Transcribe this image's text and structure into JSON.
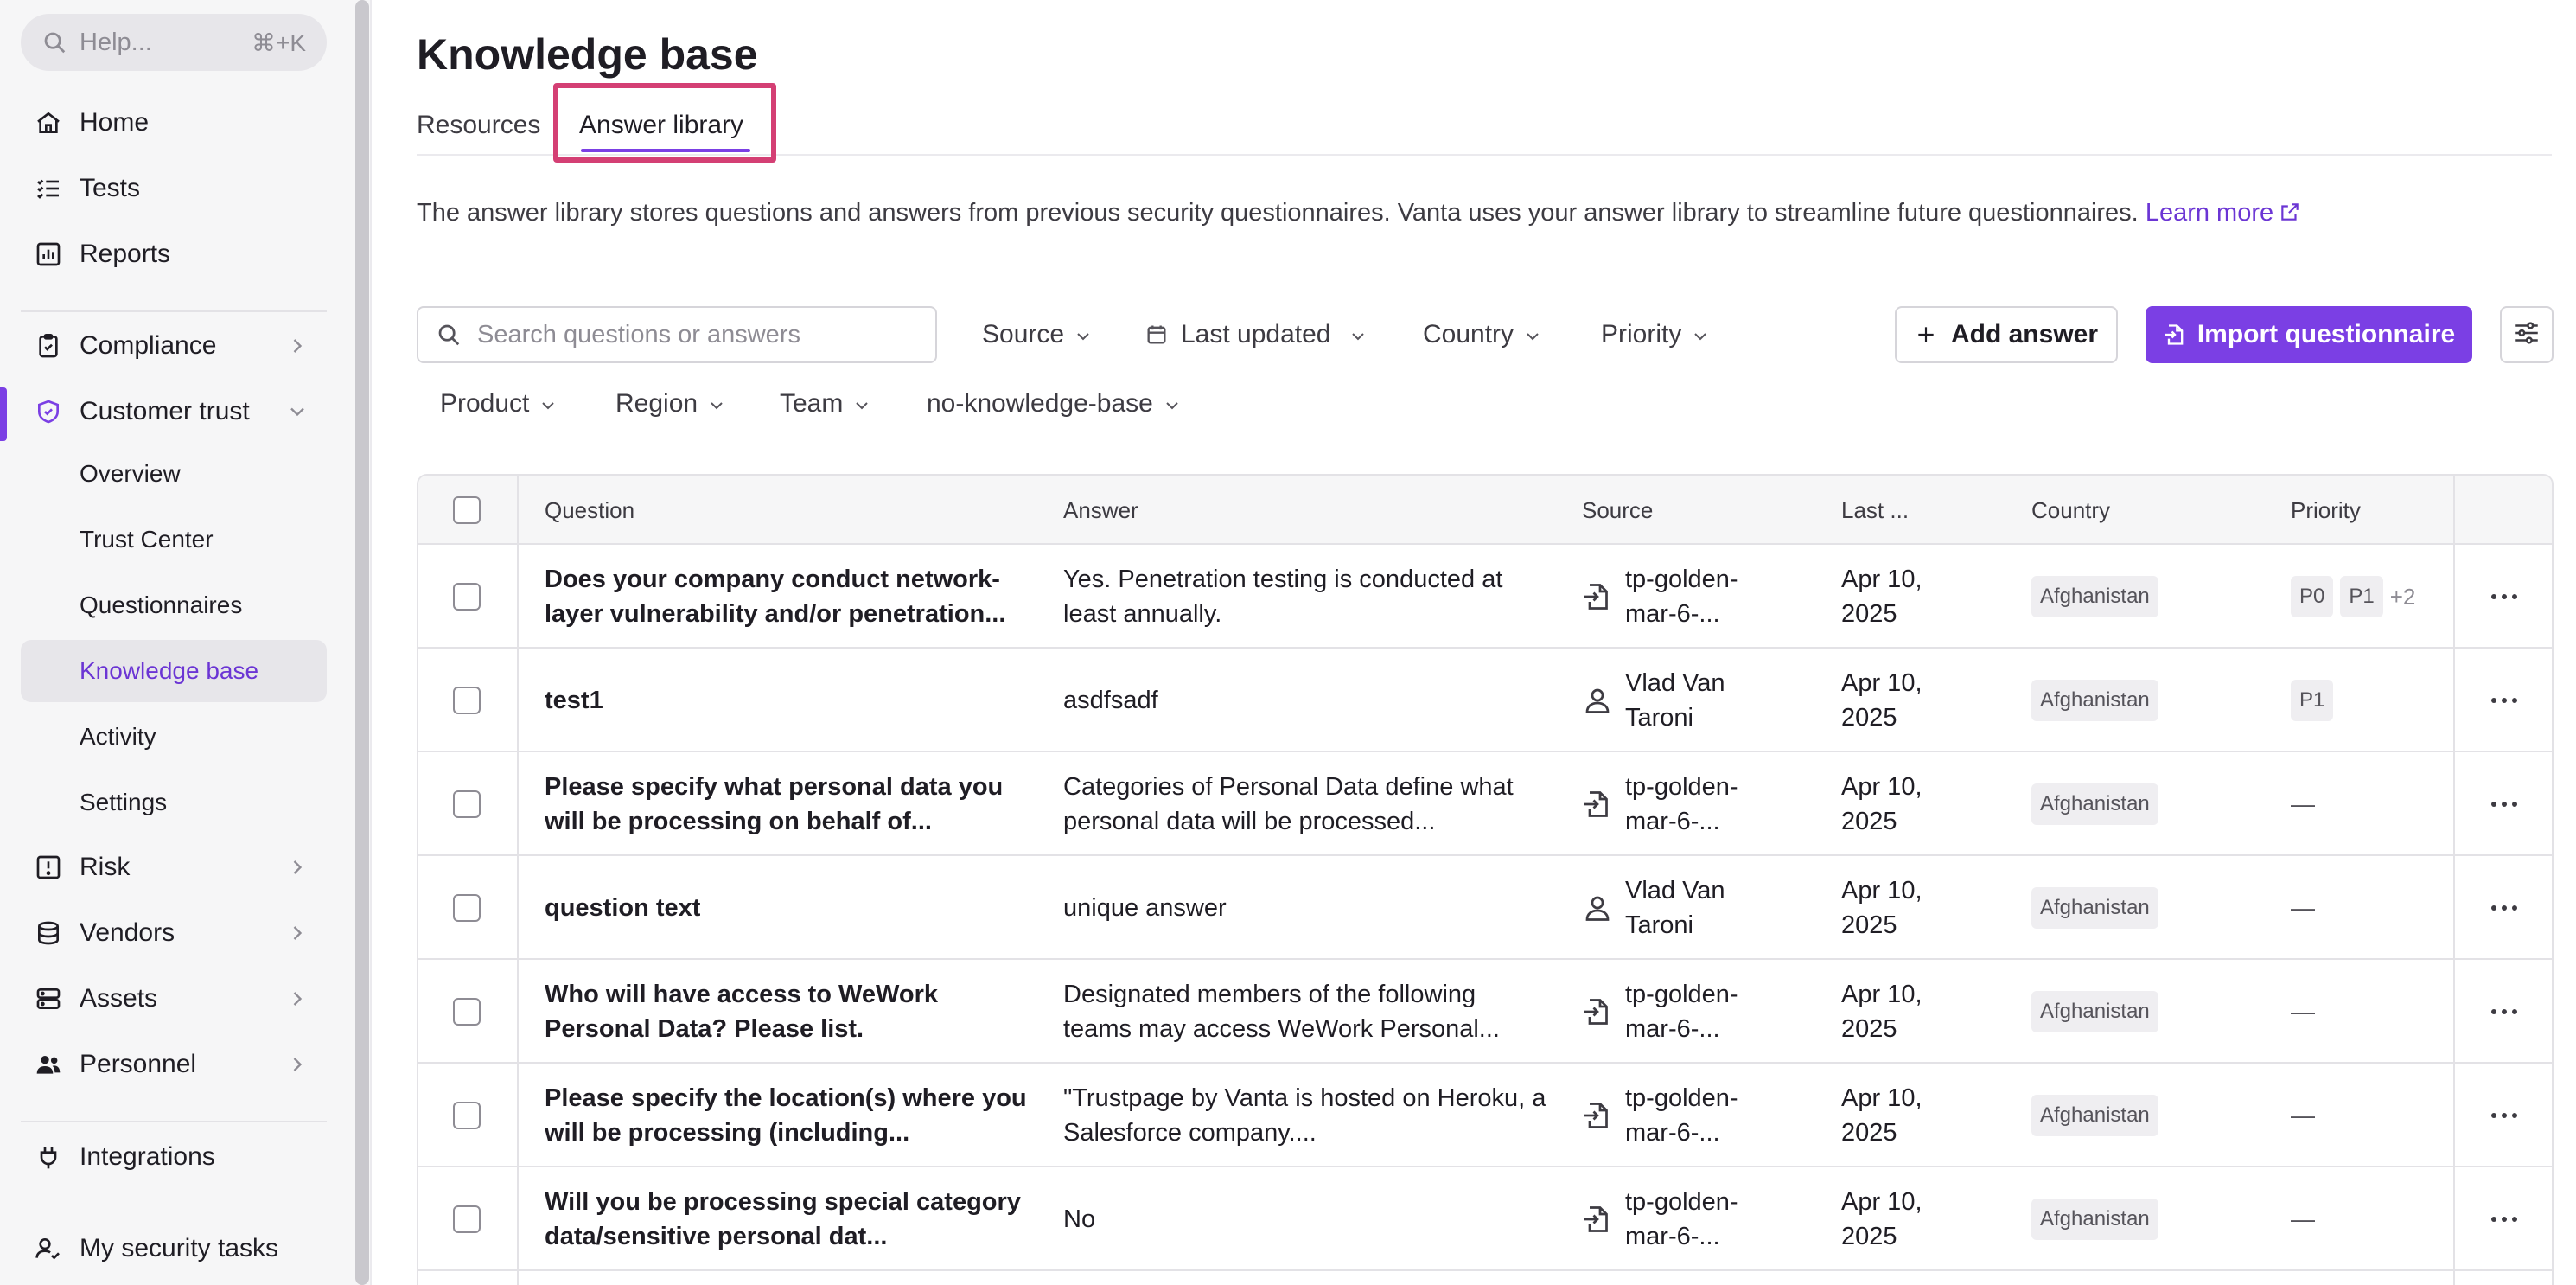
{
  "sidebar": {
    "help_placeholder": "Help...",
    "help_shortcut": "⌘+K",
    "items": [
      {
        "label": "Home",
        "icon": "home-icon"
      },
      {
        "label": "Tests",
        "icon": "list-check-icon"
      },
      {
        "label": "Reports",
        "icon": "chart-icon"
      },
      {
        "label": "Compliance",
        "icon": "clipboard-check-icon"
      },
      {
        "label": "Customer trust",
        "icon": "shield-check-icon"
      },
      {
        "label": "Risk",
        "icon": "alert-square-icon"
      },
      {
        "label": "Vendors",
        "icon": "stack-icon"
      },
      {
        "label": "Assets",
        "icon": "server-icon"
      },
      {
        "label": "Personnel",
        "icon": "users-icon"
      },
      {
        "label": "Integrations",
        "icon": "plug-icon"
      },
      {
        "label": "My security tasks",
        "icon": "user-check-icon"
      }
    ],
    "customer_trust_sub": [
      {
        "label": "Overview"
      },
      {
        "label": "Trust Center"
      },
      {
        "label": "Questionnaires"
      },
      {
        "label": "Knowledge base"
      },
      {
        "label": "Activity"
      },
      {
        "label": "Settings"
      }
    ]
  },
  "page": {
    "title": "Knowledge base",
    "tabs": [
      {
        "label": "Resources"
      },
      {
        "label": "Answer library"
      }
    ],
    "description": "The answer library stores questions and answers from previous security questionnaires. Vanta uses your answer library to streamline future questionnaires.",
    "learn_more": "Learn more"
  },
  "toolbar": {
    "search_placeholder": "Search questions or answers",
    "filters": [
      "Source",
      "Last updated",
      "Country",
      "Priority",
      "Product",
      "Region",
      "Team",
      "no-knowledge-base"
    ],
    "add_answer": "Add answer",
    "import_questionnaire": "Import questionnaire"
  },
  "table": {
    "columns": [
      "Question",
      "Answer",
      "Source",
      "Last ...",
      "Country",
      "Priority"
    ],
    "rows": [
      {
        "question": "Does your company conduct network-layer vulnerability and/or penetration...",
        "answer": "Yes. Penetration testing is conducted at least annually.",
        "source_type": "import",
        "source": "tp-golden-mar-6-...",
        "updated": "Apr 10, 2025",
        "country": "Afghanistan",
        "priority": [
          "P0",
          "P1"
        ],
        "priority_more": "+2"
      },
      {
        "question": "test1",
        "answer": "asdfsadf",
        "source_type": "user",
        "source": "Vlad Van Taroni",
        "updated": "Apr 10, 2025",
        "country": "Afghanistan",
        "priority": [
          "P1"
        ],
        "priority_more": ""
      },
      {
        "question": "Please specify what personal data you will be processing on behalf of...",
        "answer": "Categories of Personal Data define what personal data will be processed...",
        "source_type": "import",
        "source": "tp-golden-mar-6-...",
        "updated": "Apr 10, 2025",
        "country": "Afghanistan",
        "priority": [],
        "priority_more": "—"
      },
      {
        "question": "question text",
        "answer": "unique answer",
        "source_type": "user",
        "source": "Vlad Van Taroni",
        "updated": "Apr 10, 2025",
        "country": "Afghanistan",
        "priority": [],
        "priority_more": "—"
      },
      {
        "question": "Who will have access to WeWork Personal Data? Please list.",
        "answer": "Designated members of the following teams may access WeWork Personal...",
        "source_type": "import",
        "source": "tp-golden-mar-6-...",
        "updated": "Apr 10, 2025",
        "country": "Afghanistan",
        "priority": [],
        "priority_more": "—"
      },
      {
        "question": "Please specify the location(s) where you will be processing (including...",
        "answer": "\"Trustpage by Vanta is hosted on Heroku, a Salesforce company....",
        "source_type": "import",
        "source": "tp-golden-mar-6-...",
        "updated": "Apr 10, 2025",
        "country": "Afghanistan",
        "priority": [],
        "priority_more": "—"
      },
      {
        "question": "Will you be processing special category data/sensitive personal dat...",
        "answer": "No",
        "source_type": "import",
        "source": "tp-golden-mar-6-...",
        "updated": "Apr 10, 2025",
        "country": "Afghanistan",
        "priority": [],
        "priority_more": "—"
      }
    ]
  },
  "colors": {
    "accent": "#7b3fe4",
    "highlight": "#d43f74"
  }
}
